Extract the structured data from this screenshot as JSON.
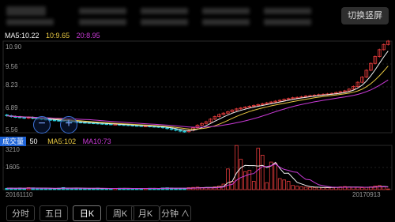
{
  "header": {
    "switch_label": "切换竖屏"
  },
  "ma": {
    "ma5": "MA5:10.22",
    "ma10": "10:9.65",
    "ma20": "20:8.95"
  },
  "volume": {
    "label": "成交量",
    "value": "50",
    "ma5": "MA5:102",
    "ma10": "MA10:73"
  },
  "zoom": {
    "out": "−",
    "in": "+"
  },
  "tabs": [
    {
      "label": "分时"
    },
    {
      "label": "五日"
    },
    {
      "label": "日K"
    },
    {
      "label": "周K"
    },
    {
      "label": "月K"
    },
    {
      "label": "分钟 ∧"
    }
  ],
  "active_tab": "日K",
  "colors": {
    "up": "#e83c3c",
    "down": "#27c8d6",
    "ma5": "#f2f2f2",
    "ma10": "#e8c842",
    "ma20": "#c93ad6"
  },
  "chart_data": {
    "type": "candlestick",
    "price_ticks": [
      "10.90",
      "9.56",
      "8.23",
      "6.89",
      "5.56"
    ],
    "price_range": [
      5.56,
      10.9
    ],
    "volume_ticks": [
      "3210",
      "1605"
    ],
    "volume_range": [
      0,
      3210
    ],
    "x_start": "20161110",
    "x_end": "20170913",
    "close": [
      6.55,
      6.5,
      6.48,
      6.45,
      6.42,
      6.45,
      6.4,
      6.38,
      6.35,
      6.33,
      6.3,
      6.28,
      6.27,
      6.25,
      6.22,
      6.2,
      6.18,
      6.16,
      6.15,
      6.13,
      6.12,
      6.1,
      6.08,
      6.07,
      6.05,
      6.05,
      6.03,
      6.02,
      6.0,
      5.98,
      5.97,
      5.95,
      5.95,
      5.93,
      5.92,
      5.9,
      5.85,
      5.8,
      5.75,
      5.7,
      5.65,
      5.62,
      5.7,
      5.85,
      6.0,
      6.1,
      6.2,
      6.35,
      6.5,
      6.62,
      6.7,
      6.78,
      6.88,
      6.95,
      7.0,
      7.05,
      7.1,
      7.15,
      7.2,
      7.25,
      7.3,
      7.35,
      7.4,
      7.45,
      7.5,
      7.55,
      7.6,
      7.62,
      7.65,
      7.7,
      7.72,
      7.75,
      7.78,
      7.8,
      7.82,
      7.85,
      7.9,
      7.95,
      8.0,
      8.1,
      8.25,
      8.5,
      8.8,
      9.2,
      9.6,
      10.0,
      10.4,
      10.7,
      10.9
    ],
    "volume": [
      95,
      110,
      80,
      120,
      90,
      140,
      130,
      100,
      85,
      90,
      80,
      75,
      110,
      150,
      120,
      90,
      100,
      95,
      80,
      85,
      90,
      110,
      70,
      80,
      85,
      90,
      100,
      95,
      80,
      75,
      90,
      85,
      80,
      100,
      90,
      80,
      120,
      130,
      110,
      90,
      80,
      70,
      140,
      160,
      180,
      150,
      140,
      130,
      200,
      260,
      400,
      1500,
      600,
      3200,
      2200,
      1300,
      1400,
      600,
      3000,
      2500,
      500,
      2000,
      1900,
      800,
      700,
      600,
      300,
      250,
      200,
      180,
      160,
      150,
      170,
      150,
      140,
      160,
      180,
      200,
      220,
      190,
      170,
      160,
      140,
      180,
      200,
      260,
      300,
      220,
      50
    ],
    "ma5_price": "10.22",
    "ma10_price": "9.65",
    "ma20_price": "8.95"
  }
}
